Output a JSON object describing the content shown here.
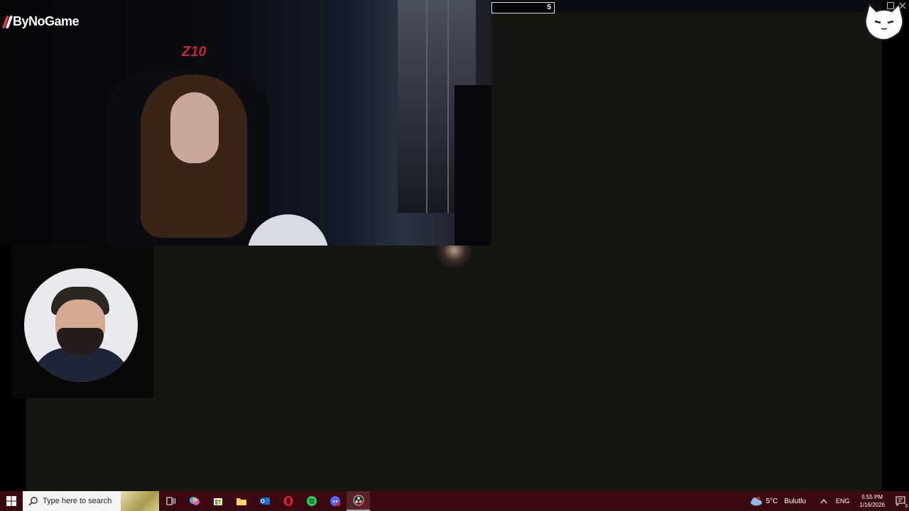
{
  "overlay": {
    "brand": "ByNoGame",
    "counter_value": "5"
  },
  "webcam": {
    "chair_logo": "Z10"
  },
  "taskbar": {
    "search_placeholder": "Type here to search",
    "pinned_apps": [
      "task-view",
      "copilot",
      "store",
      "file-explorer",
      "outlook",
      "opera",
      "spotify",
      "discord",
      "obs"
    ],
    "weather_temp": "5°C",
    "weather_desc": "Bulutlu",
    "language": "ENG",
    "time": "5:55 PM",
    "date": "1/16/2026",
    "notification_count": "3"
  },
  "colors": {
    "taskbar_bg": "#3b0a10",
    "stream_bg": "#15160f",
    "brand_accent": "#e23a3a"
  }
}
